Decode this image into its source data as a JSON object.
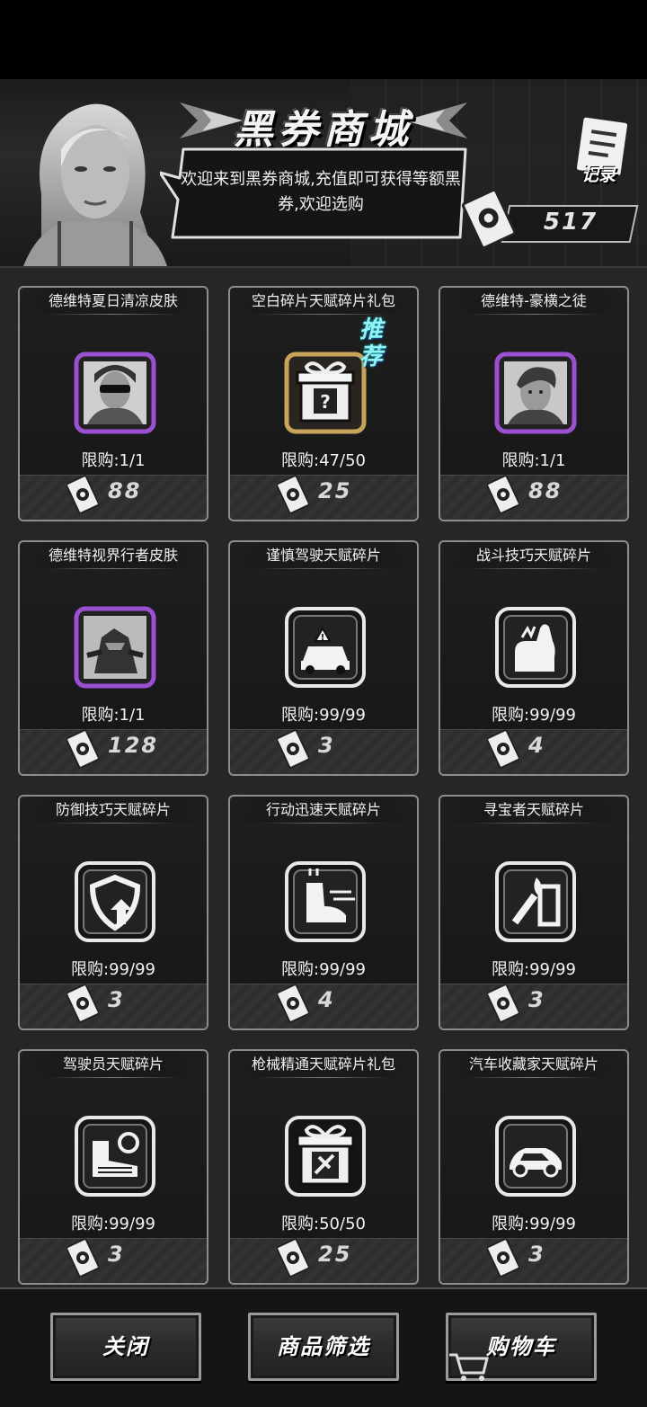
{
  "header": {
    "title": "黑券商城",
    "welcome": "欢迎来到黑券商城,充值即可获得等额黑券,欢迎选购",
    "record_label": "记录",
    "balance": "517"
  },
  "items": [
    {
      "name": "德维特夏日清凉皮肤",
      "limit": "限购:1/1",
      "price": "88",
      "icon": "avatar-sunglasses-icon"
    },
    {
      "name": "空白碎片天赋碎片礼包",
      "limit": "限购:47/50",
      "price": "25",
      "icon": "mystery-gift-icon",
      "badge": "推荐"
    },
    {
      "name": "德维特-豪横之徒",
      "limit": "限购:1/1",
      "price": "88",
      "icon": "avatar-man-icon"
    },
    {
      "name": "德维特视界行者皮肤",
      "limit": "限购:1/1",
      "price": "128",
      "icon": "avatar-armor-icon"
    },
    {
      "name": "谨慎驾驶天赋碎片",
      "limit": "限购:99/99",
      "price": "3",
      "icon": "careful-driving-icon"
    },
    {
      "name": "战斗技巧天赋碎片",
      "limit": "限购:99/99",
      "price": "4",
      "icon": "combat-fist-icon"
    },
    {
      "name": "防御技巧天赋碎片",
      "limit": "限购:99/99",
      "price": "3",
      "icon": "shield-up-icon"
    },
    {
      "name": "行动迅速天赋碎片",
      "limit": "限购:99/99",
      "price": "4",
      "icon": "fast-boot-icon"
    },
    {
      "name": "寻宝者天赋碎片",
      "limit": "限购:99/99",
      "price": "3",
      "icon": "treasure-torch-icon"
    },
    {
      "name": "驾驶员天赋碎片",
      "limit": "限购:99/99",
      "price": "3",
      "icon": "driver-wheel-icon"
    },
    {
      "name": "枪械精通天赋碎片礼包",
      "limit": "限购:50/50",
      "price": "25",
      "icon": "gun-gift-icon"
    },
    {
      "name": "汽车收藏家天赋碎片",
      "limit": "限购:99/99",
      "price": "3",
      "icon": "car-collector-icon"
    }
  ],
  "footer": {
    "close": "关闭",
    "filter": "商品筛选",
    "cart": "购物车"
  }
}
